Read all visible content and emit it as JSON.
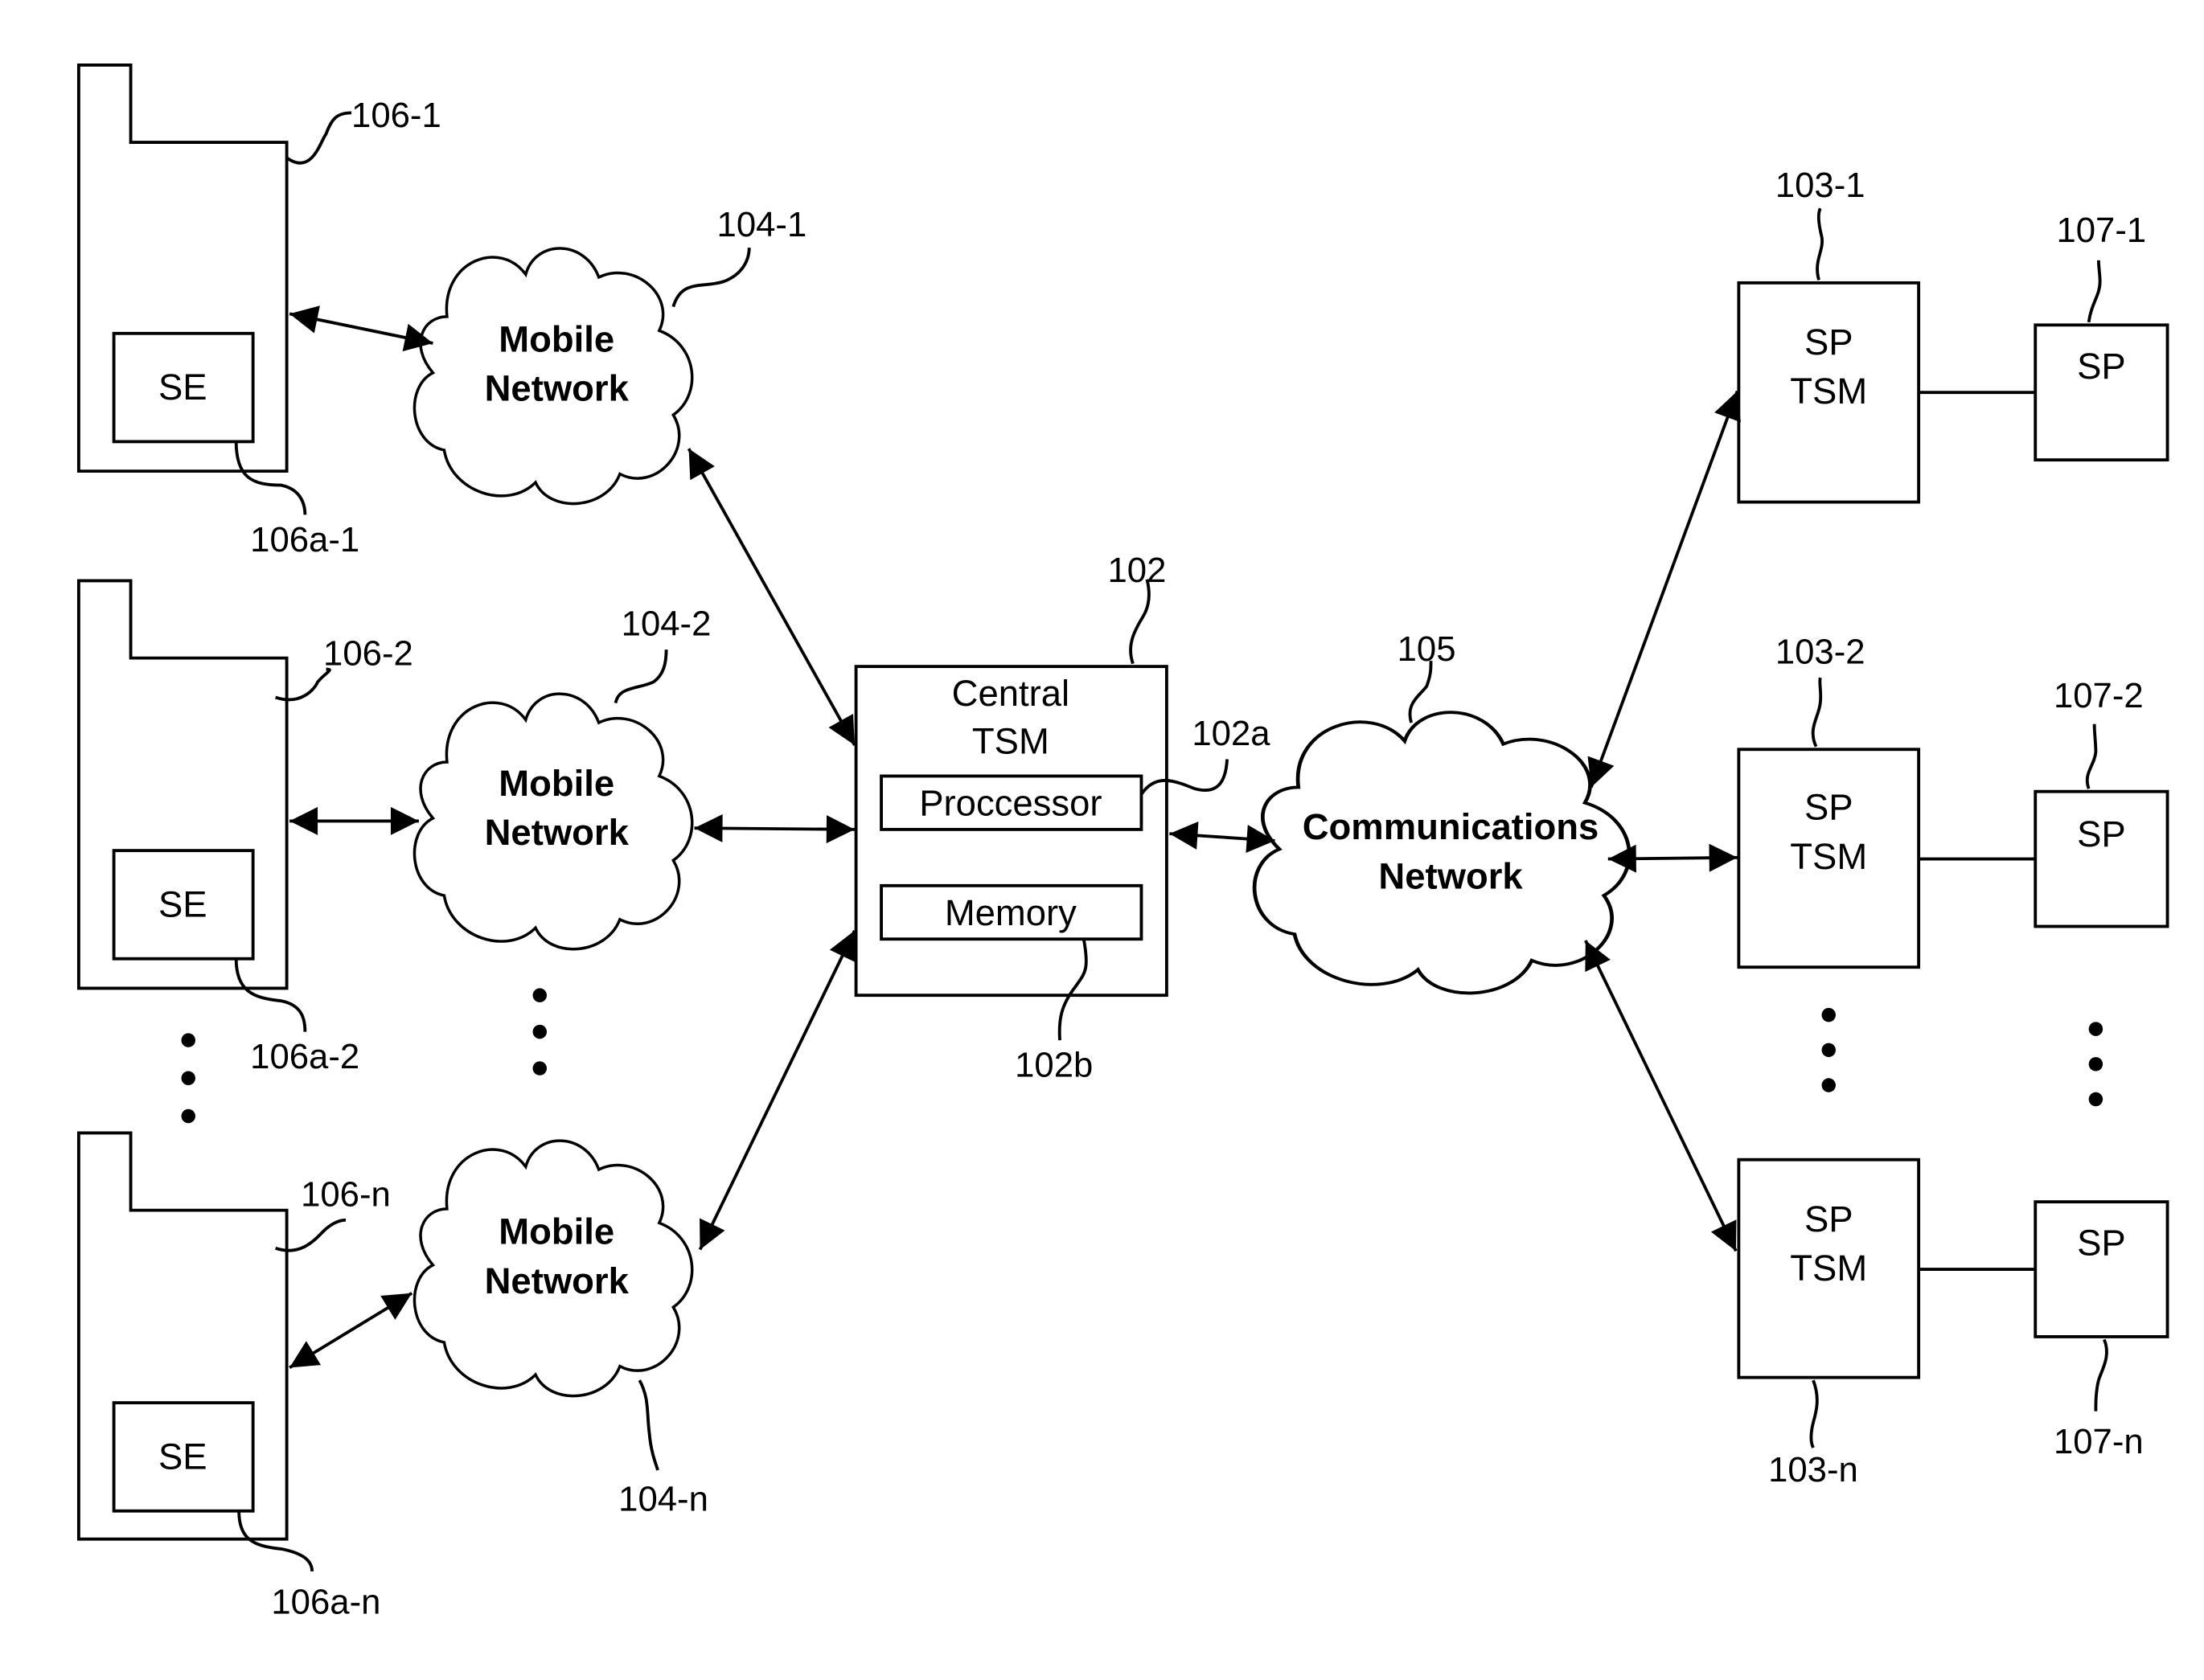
{
  "diagram": {
    "central_tsm": {
      "ref": "102",
      "title_line1": "Central",
      "title_line2": "TSM",
      "processor": {
        "label": "Proccessor",
        "ref": "102a"
      },
      "memory": {
        "label": "Memory",
        "ref": "102b"
      }
    },
    "communications_network": {
      "ref": "105",
      "line1": "Communications",
      "line2": "Network"
    },
    "mobile_devices": [
      {
        "ref": "106-1",
        "se_label": "SE",
        "se_ref": "106a-1"
      },
      {
        "ref": "106-2",
        "se_label": "SE",
        "se_ref": "106a-2"
      },
      {
        "ref": "106-n",
        "se_label": "SE",
        "se_ref": "106a-n"
      }
    ],
    "mobile_networks": [
      {
        "ref": "104-1",
        "line1": "Mobile",
        "line2": "Network"
      },
      {
        "ref": "104-2",
        "line1": "Mobile",
        "line2": "Network"
      },
      {
        "ref": "104-n",
        "line1": "Mobile",
        "line2": "Network"
      }
    ],
    "sp_tsms": [
      {
        "ref": "103-1",
        "line1": "SP",
        "line2": "TSM"
      },
      {
        "ref": "103-2",
        "line1": "SP",
        "line2": "TSM"
      },
      {
        "ref": "103-n",
        "line1": "SP",
        "line2": "TSM"
      }
    ],
    "service_providers": [
      {
        "ref": "107-1",
        "label": "SP"
      },
      {
        "ref": "107-2",
        "label": "SP"
      },
      {
        "ref": "107-n",
        "label": "SP"
      }
    ]
  }
}
